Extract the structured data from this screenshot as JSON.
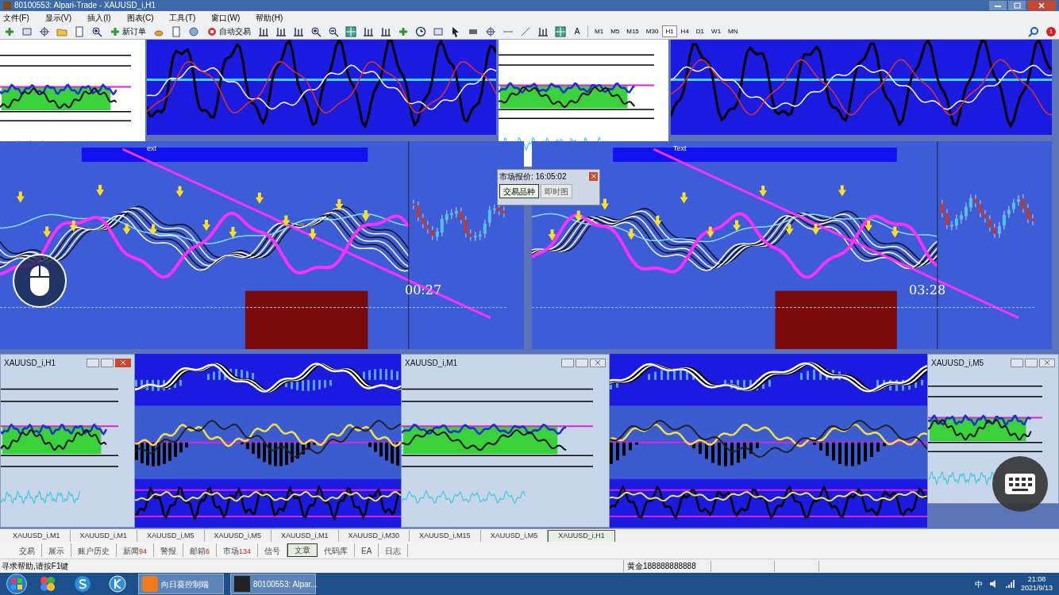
{
  "window": {
    "title": "80100553: Alpari-Trade - XAUUSD_i,H1"
  },
  "menu": [
    "文件(F)",
    "显示(V)",
    "插入(I)",
    "图表(C)",
    "工具(T)",
    "窗口(W)",
    "帮助(H)"
  ],
  "toolbar": {
    "new_order": "新订单",
    "auto_trading": "自动交易",
    "text_tool": "A",
    "timeframes": [
      {
        "label": "M1",
        "selected": false
      },
      {
        "label": "M5",
        "selected": false
      },
      {
        "label": "M15",
        "selected": false
      },
      {
        "label": "M30",
        "selected": false
      },
      {
        "label": "H1",
        "selected": true
      },
      {
        "label": "H4",
        "selected": false
      },
      {
        "label": "D1",
        "selected": false
      },
      {
        "label": "W1",
        "selected": false
      },
      {
        "label": "MN",
        "selected": false
      }
    ],
    "notification_count": "1"
  },
  "charts": [
    {
      "text_label": "ext",
      "timer": "00:27"
    },
    {
      "text_label": "Text",
      "timer": "03:28"
    }
  ],
  "market_watch": {
    "title": "市场报价: 16:05:02",
    "tabs": [
      {
        "label": "交易品种",
        "selected": true
      },
      {
        "label": "即时图",
        "selected": false
      }
    ]
  },
  "mdi_windows": [
    {
      "title": "XAUUSD_i,H1",
      "active": true
    },
    {
      "title": "XAUUSD_i,M1",
      "active": false
    },
    {
      "title": "XAUUSD_i,M5",
      "active": false
    }
  ],
  "chart_tabs": [
    {
      "label": "XAUUSD_i,M1",
      "selected": false
    },
    {
      "label": "XAUUSD_i,M1",
      "selected": false
    },
    {
      "label": "XAUUSD_i,M5",
      "selected": false
    },
    {
      "label": "XAUUSD_i,M5",
      "selected": false
    },
    {
      "label": "XAUUSD_i,M1",
      "selected": false
    },
    {
      "label": "XAUUSD_i,M30",
      "selected": false
    },
    {
      "label": "XAUUSD_i,M15",
      "selected": false
    },
    {
      "label": "XAUUSD_i,M5",
      "selected": false
    },
    {
      "label": "XAUUSD_i,H1",
      "selected": true
    }
  ],
  "terminal_tabs": [
    {
      "label": "交易",
      "selected": false
    },
    {
      "label": "展示",
      "selected": false
    },
    {
      "label": "账户历史",
      "selected": false
    },
    {
      "label": "新闻",
      "count": "94",
      "selected": false
    },
    {
      "label": "警报",
      "selected": false
    },
    {
      "label": "邮箱",
      "count": "6",
      "selected": false
    },
    {
      "label": "市场",
      "count": "134",
      "selected": false
    },
    {
      "label": "信号",
      "selected": false
    },
    {
      "label": "文章",
      "selected": true
    },
    {
      "label": "代码库",
      "selected": false
    },
    {
      "label": "EA",
      "selected": false
    },
    {
      "label": "日志",
      "selected": false
    }
  ],
  "status_bar": {
    "help": "寻求帮助,请按F1键",
    "account": "黄金188888888888"
  },
  "taskbar": {
    "apps": [
      {
        "label": "向日葵控制端"
      },
      {
        "label": "80100553: Alpar..."
      }
    ],
    "ime": "中",
    "time": "21:08",
    "date": "2021/9/13"
  }
}
